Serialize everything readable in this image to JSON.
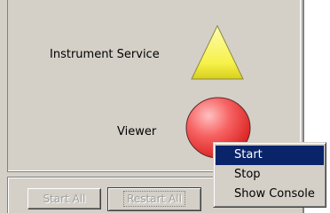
{
  "services": [
    {
      "label": "Instrument Service",
      "icon": "warning-triangle-icon",
      "color": "#f7f14a"
    },
    {
      "label": "Viewer",
      "icon": "stopped-circle-icon",
      "color": "#f23a3a"
    }
  ],
  "buttons": {
    "start_all": "Start All",
    "restart_all": "Restart All"
  },
  "context_menu": {
    "items": [
      "Start",
      "Stop",
      "Show Console"
    ],
    "selected": "Start"
  },
  "colors": {
    "window_bg": "#d4d0c8",
    "menu_highlight": "#0a246a",
    "triangle_fill": "#f7f14a",
    "circle_fill": "#f23a3a"
  }
}
